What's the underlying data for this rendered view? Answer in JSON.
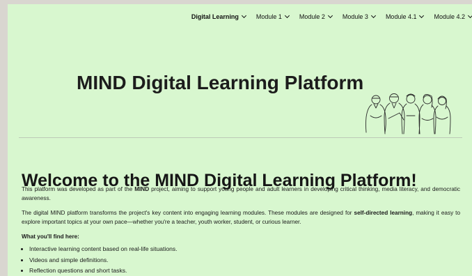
{
  "nav": {
    "items": [
      {
        "label": "Digital Learning"
      },
      {
        "label": "Module 1"
      },
      {
        "label": "Module 2"
      },
      {
        "label": "Module 3"
      },
      {
        "label": "Module 4.1"
      },
      {
        "label": "Module 4.2"
      }
    ]
  },
  "hero": {
    "title": "MIND Digital Learning Platform",
    "illustration_icon": "people-group-line-art"
  },
  "main": {
    "heading": "Welcome to the MIND Digital Learning Platform!",
    "p1": {
      "before": "This platform was developed as part of the ",
      "strong": "MIND",
      "after": " project, aiming to support young people and adult learners in developing critical thinking, media literacy, and democratic awareness."
    },
    "p2": {
      "before": "The digital MIND platform transforms the project's key content into engaging learning modules. These modules are designed for ",
      "strong": "self-directed learning",
      "after": ", making it easy to explore important topics at your own pace—whether you're a teacher, youth worker, student, or curious learner."
    },
    "find_title": "What you'll find here:",
    "features": [
      "Interactive learning content based on real-life situations.",
      "Videos and simple definitions.",
      "Reflection questions and short tasks."
    ]
  },
  "colors": {
    "page_background": "#d8f7cf",
    "outer_background": "#d9d6d0",
    "text": "#1a1a1a"
  }
}
